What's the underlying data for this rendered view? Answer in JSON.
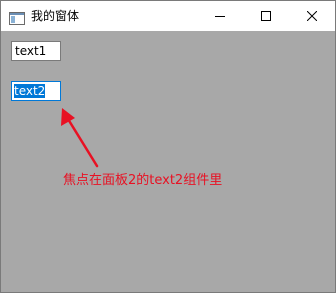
{
  "window": {
    "title": "我的窗体",
    "icons": {
      "app": "app-window-icon",
      "minimize": "minimize-icon",
      "maximize": "maximize-icon",
      "close": "close-icon"
    }
  },
  "panel1": {
    "textbox": {
      "value": "text1"
    }
  },
  "panel2": {
    "textbox": {
      "value": "text2",
      "focused": true,
      "selected_all": true
    }
  },
  "annotation": {
    "text": "焦点在面板2的text2组件里",
    "color": "#e81123"
  },
  "colors": {
    "client_background": "#a8a8a8",
    "focus_border": "#0078d7",
    "selection": "#0078d7"
  }
}
